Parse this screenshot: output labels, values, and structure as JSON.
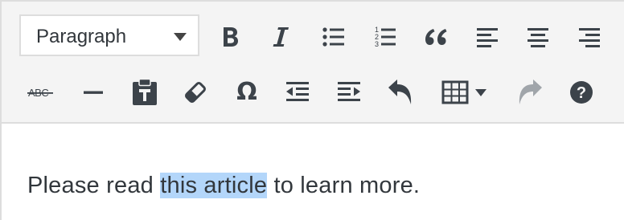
{
  "toolbar": {
    "format_select": {
      "value": "Paragraph"
    },
    "row1": [
      {
        "name": "bold-button",
        "icon": "bold-icon",
        "tooltip": "Bold"
      },
      {
        "name": "italic-button",
        "icon": "italic-icon",
        "tooltip": "Italic"
      },
      {
        "name": "bulleted-list-button",
        "icon": "bulleted-list-icon",
        "tooltip": "Bulleted list"
      },
      {
        "name": "numbered-list-button",
        "icon": "numbered-list-icon",
        "tooltip": "Numbered list"
      },
      {
        "name": "blockquote-button",
        "icon": "blockquote-icon",
        "tooltip": "Blockquote"
      },
      {
        "name": "align-left-button",
        "icon": "align-left-icon",
        "tooltip": "Align left"
      },
      {
        "name": "align-center-button",
        "icon": "align-center-icon",
        "tooltip": "Align center"
      },
      {
        "name": "align-right-button",
        "icon": "align-right-icon",
        "tooltip": "Align right"
      }
    ],
    "row2": [
      {
        "name": "strikethrough-button",
        "icon": "strikethrough-icon",
        "text": "ABC"
      },
      {
        "name": "horizontal-line-button",
        "icon": "horizontal-line-icon"
      },
      {
        "name": "paste-as-text-button",
        "icon": "clipboard-icon"
      },
      {
        "name": "clear-formatting-button",
        "icon": "eraser-icon"
      },
      {
        "name": "special-character-button",
        "icon": "omega-icon",
        "text": "Ω"
      },
      {
        "name": "decrease-indent-button",
        "icon": "outdent-icon"
      },
      {
        "name": "increase-indent-button",
        "icon": "indent-icon"
      },
      {
        "name": "undo-button",
        "icon": "undo-icon"
      },
      {
        "name": "table-button",
        "icon": "table-icon"
      },
      {
        "name": "redo-button",
        "icon": "redo-icon",
        "disabled": true
      },
      {
        "name": "help-button",
        "icon": "help-icon"
      }
    ],
    "icon_color": "#32373c",
    "disabled_icon_color": "#a0a5aa"
  },
  "content": {
    "before_text": "Please read ",
    "selected_text": "this article",
    "after_text": " to learn more.",
    "selection_color": "#b3d6fa"
  }
}
